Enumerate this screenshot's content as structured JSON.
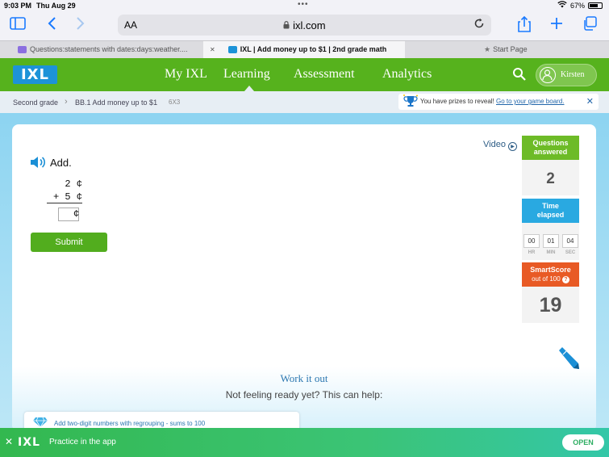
{
  "status_bar": {
    "time": "9:03 PM",
    "date": "Thu Aug 29",
    "dots": "•••",
    "battery": "67%"
  },
  "browser": {
    "aa": "AA",
    "url": "ixl.com",
    "tabs": [
      {
        "label": "Questions:statements with dates:days:weather...."
      },
      {
        "label": "IXL | Add money up to $1 | 2nd grade math"
      },
      {
        "label": "Start Page"
      }
    ],
    "close_glyph": "✕"
  },
  "nav": {
    "logo": "IXL",
    "links": [
      "My IXL",
      "Learning",
      "Assessment",
      "Analytics"
    ],
    "user_name": "Kirsten"
  },
  "breadcrumb": {
    "level": "Second grade",
    "skill": "BB.1 Add money up to $1",
    "code": "6X3",
    "prize_text": "You have prizes to reveal!",
    "prize_link": "Go to your game board."
  },
  "question": {
    "video": "Video",
    "prompt": "Add.",
    "line1": "  2 ¢",
    "line2": "+ 5 ¢",
    "cent": "¢",
    "submit": "Submit"
  },
  "stats": {
    "answered_label_1": "Questions",
    "answered_label_2": "answered",
    "answered_value": "2",
    "time_label_1": "Time",
    "time_label_2": "elapsed",
    "hr": "00",
    "min": "01",
    "sec": "04",
    "hr_label": "HR",
    "min_label": "MIN",
    "sec_label": "SEC",
    "score_label": "SmartScore",
    "score_sub": "out of 100",
    "score_help": "?",
    "score_value": "19"
  },
  "work_it_out": {
    "title": "Work it out",
    "subtitle": "Not feeling ready yet? This can help:",
    "skill": "Add two-digit numbers with regrouping - sums to 100"
  },
  "banner": {
    "close": "✕",
    "logo": "IXL",
    "text": "Practice in the app",
    "open": "OPEN"
  },
  "colors": {
    "green": "#56b21d",
    "blue": "#1d93d8",
    "time_blue": "#29a9e1",
    "score_orange": "#e85a25"
  }
}
